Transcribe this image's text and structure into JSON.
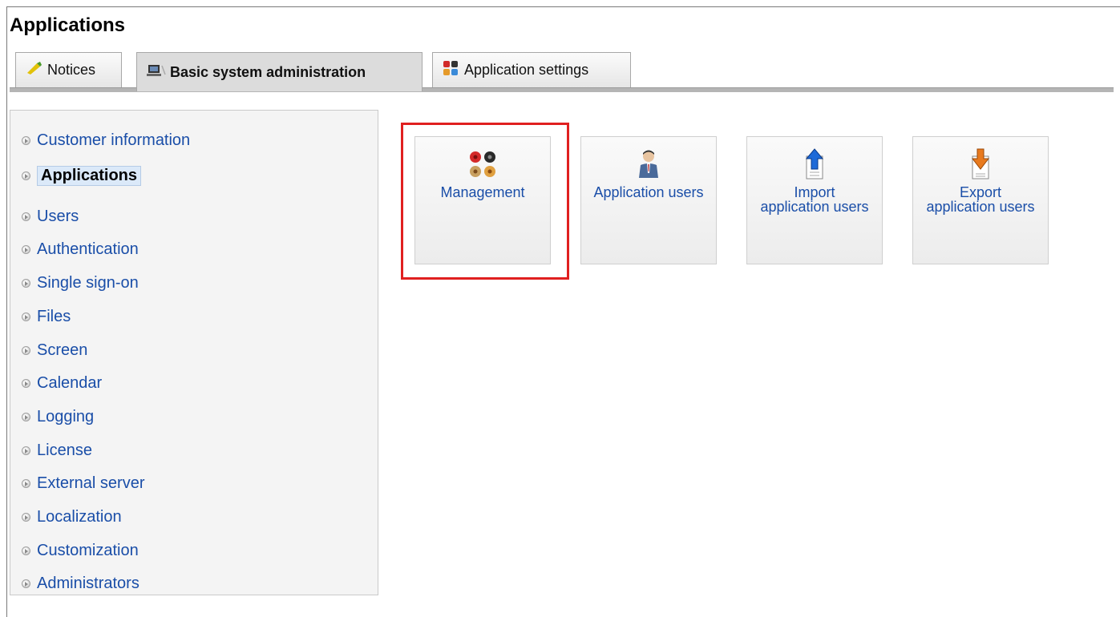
{
  "page": {
    "title": "Applications"
  },
  "tabs": [
    {
      "label": "Notices",
      "icon": "notices-icon"
    },
    {
      "label": "Basic system administration",
      "icon": "computer-icon"
    },
    {
      "label": "Application settings",
      "icon": "app-settings-icon"
    }
  ],
  "sidebar": {
    "items": [
      {
        "label": "Customer information"
      },
      {
        "label": "Applications"
      },
      {
        "label": "Users"
      },
      {
        "label": "Authentication"
      },
      {
        "label": "Single sign-on"
      },
      {
        "label": "Files"
      },
      {
        "label": "Screen"
      },
      {
        "label": "Calendar"
      },
      {
        "label": "Logging"
      },
      {
        "label": "License"
      },
      {
        "label": "External server"
      },
      {
        "label": "Localization"
      },
      {
        "label": "Customization"
      },
      {
        "label": "Administrators"
      }
    ],
    "active": "Applications"
  },
  "cards": [
    {
      "label": "Management",
      "icon": "management-icon"
    },
    {
      "label": "Application users",
      "icon": "user-icon"
    },
    {
      "label": "Import application users",
      "icon": "import-icon"
    },
    {
      "label": "Export application users",
      "icon": "export-icon"
    }
  ],
  "colors": {
    "link": "#1a4ea8",
    "highlight": "#e02020"
  }
}
